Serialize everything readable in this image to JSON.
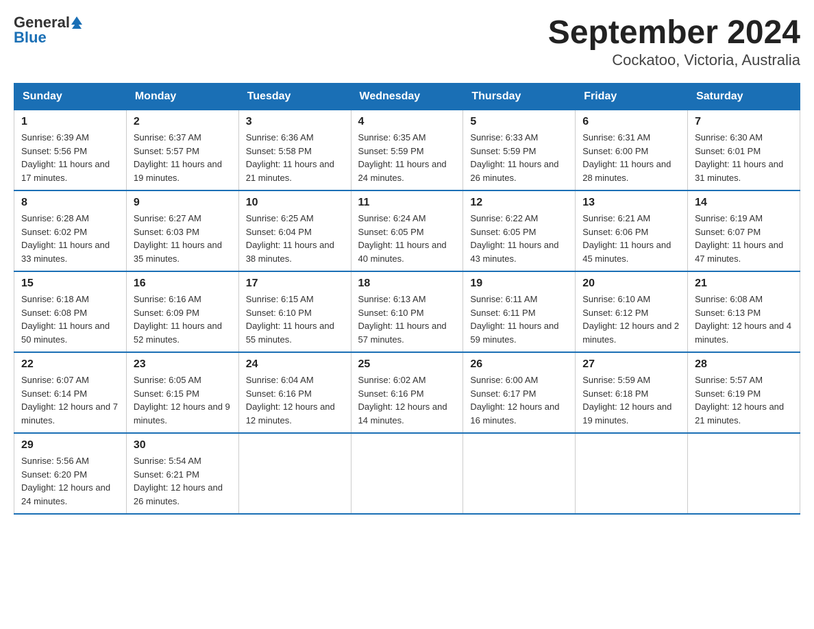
{
  "logo": {
    "text_general": "General",
    "text_blue": "Blue"
  },
  "title": "September 2024",
  "subtitle": "Cockatoo, Victoria, Australia",
  "days_of_week": [
    "Sunday",
    "Monday",
    "Tuesday",
    "Wednesday",
    "Thursday",
    "Friday",
    "Saturday"
  ],
  "weeks": [
    [
      {
        "day": "1",
        "sunrise": "6:39 AM",
        "sunset": "5:56 PM",
        "daylight": "11 hours and 17 minutes."
      },
      {
        "day": "2",
        "sunrise": "6:37 AM",
        "sunset": "5:57 PM",
        "daylight": "11 hours and 19 minutes."
      },
      {
        "day": "3",
        "sunrise": "6:36 AM",
        "sunset": "5:58 PM",
        "daylight": "11 hours and 21 minutes."
      },
      {
        "day": "4",
        "sunrise": "6:35 AM",
        "sunset": "5:59 PM",
        "daylight": "11 hours and 24 minutes."
      },
      {
        "day": "5",
        "sunrise": "6:33 AM",
        "sunset": "5:59 PM",
        "daylight": "11 hours and 26 minutes."
      },
      {
        "day": "6",
        "sunrise": "6:31 AM",
        "sunset": "6:00 PM",
        "daylight": "11 hours and 28 minutes."
      },
      {
        "day": "7",
        "sunrise": "6:30 AM",
        "sunset": "6:01 PM",
        "daylight": "11 hours and 31 minutes."
      }
    ],
    [
      {
        "day": "8",
        "sunrise": "6:28 AM",
        "sunset": "6:02 PM",
        "daylight": "11 hours and 33 minutes."
      },
      {
        "day": "9",
        "sunrise": "6:27 AM",
        "sunset": "6:03 PM",
        "daylight": "11 hours and 35 minutes."
      },
      {
        "day": "10",
        "sunrise": "6:25 AM",
        "sunset": "6:04 PM",
        "daylight": "11 hours and 38 minutes."
      },
      {
        "day": "11",
        "sunrise": "6:24 AM",
        "sunset": "6:05 PM",
        "daylight": "11 hours and 40 minutes."
      },
      {
        "day": "12",
        "sunrise": "6:22 AM",
        "sunset": "6:05 PM",
        "daylight": "11 hours and 43 minutes."
      },
      {
        "day": "13",
        "sunrise": "6:21 AM",
        "sunset": "6:06 PM",
        "daylight": "11 hours and 45 minutes."
      },
      {
        "day": "14",
        "sunrise": "6:19 AM",
        "sunset": "6:07 PM",
        "daylight": "11 hours and 47 minutes."
      }
    ],
    [
      {
        "day": "15",
        "sunrise": "6:18 AM",
        "sunset": "6:08 PM",
        "daylight": "11 hours and 50 minutes."
      },
      {
        "day": "16",
        "sunrise": "6:16 AM",
        "sunset": "6:09 PM",
        "daylight": "11 hours and 52 minutes."
      },
      {
        "day": "17",
        "sunrise": "6:15 AM",
        "sunset": "6:10 PM",
        "daylight": "11 hours and 55 minutes."
      },
      {
        "day": "18",
        "sunrise": "6:13 AM",
        "sunset": "6:10 PM",
        "daylight": "11 hours and 57 minutes."
      },
      {
        "day": "19",
        "sunrise": "6:11 AM",
        "sunset": "6:11 PM",
        "daylight": "11 hours and 59 minutes."
      },
      {
        "day": "20",
        "sunrise": "6:10 AM",
        "sunset": "6:12 PM",
        "daylight": "12 hours and 2 minutes."
      },
      {
        "day": "21",
        "sunrise": "6:08 AM",
        "sunset": "6:13 PM",
        "daylight": "12 hours and 4 minutes."
      }
    ],
    [
      {
        "day": "22",
        "sunrise": "6:07 AM",
        "sunset": "6:14 PM",
        "daylight": "12 hours and 7 minutes."
      },
      {
        "day": "23",
        "sunrise": "6:05 AM",
        "sunset": "6:15 PM",
        "daylight": "12 hours and 9 minutes."
      },
      {
        "day": "24",
        "sunrise": "6:04 AM",
        "sunset": "6:16 PM",
        "daylight": "12 hours and 12 minutes."
      },
      {
        "day": "25",
        "sunrise": "6:02 AM",
        "sunset": "6:16 PM",
        "daylight": "12 hours and 14 minutes."
      },
      {
        "day": "26",
        "sunrise": "6:00 AM",
        "sunset": "6:17 PM",
        "daylight": "12 hours and 16 minutes."
      },
      {
        "day": "27",
        "sunrise": "5:59 AM",
        "sunset": "6:18 PM",
        "daylight": "12 hours and 19 minutes."
      },
      {
        "day": "28",
        "sunrise": "5:57 AM",
        "sunset": "6:19 PM",
        "daylight": "12 hours and 21 minutes."
      }
    ],
    [
      {
        "day": "29",
        "sunrise": "5:56 AM",
        "sunset": "6:20 PM",
        "daylight": "12 hours and 24 minutes."
      },
      {
        "day": "30",
        "sunrise": "5:54 AM",
        "sunset": "6:21 PM",
        "daylight": "12 hours and 26 minutes."
      },
      null,
      null,
      null,
      null,
      null
    ]
  ]
}
